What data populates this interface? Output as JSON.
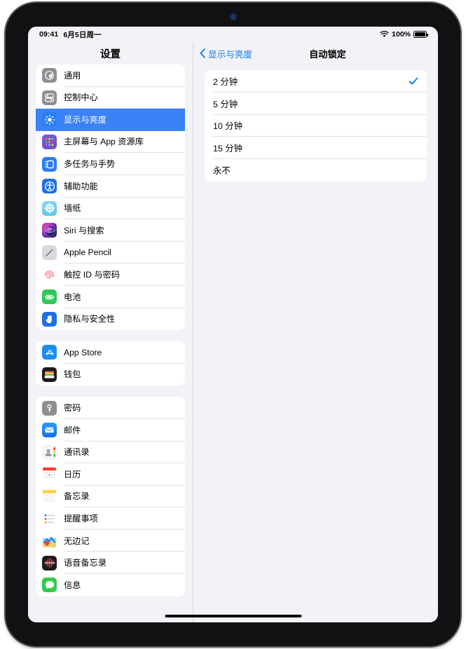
{
  "status_bar": {
    "time": "09:41",
    "date": "6月5日周一",
    "wifi_icon": "wifi-icon",
    "battery_percent": "100%",
    "battery_icon": "battery-full-icon"
  },
  "sidebar": {
    "title": "设置",
    "groups": [
      {
        "items": [
          {
            "label": "通用",
            "icon": "gear-icon",
            "icon_class": "ic-general",
            "selected": false
          },
          {
            "label": "控制中心",
            "icon": "control-center-icon",
            "icon_class": "ic-control",
            "selected": false
          },
          {
            "label": "显示与亮度",
            "icon": "brightness-icon",
            "icon_class": "ic-display",
            "selected": true
          },
          {
            "label": "主屏幕与 App 资源库",
            "icon": "app-grid-icon",
            "icon_class": "ic-home",
            "selected": false
          },
          {
            "label": "多任务与手势",
            "icon": "multitasking-icon",
            "icon_class": "ic-multi",
            "selected": false
          },
          {
            "label": "辅助功能",
            "icon": "accessibility-icon",
            "icon_class": "ic-access",
            "selected": false
          },
          {
            "label": "墙纸",
            "icon": "wallpaper-icon",
            "icon_class": "ic-wall",
            "selected": false
          },
          {
            "label": "Siri 与搜索",
            "icon": "siri-icon",
            "icon_class": "ic-siri",
            "selected": false
          },
          {
            "label": "Apple Pencil",
            "icon": "pencil-icon",
            "icon_class": "ic-pencil",
            "selected": false
          },
          {
            "label": "触控 ID 与密码",
            "icon": "fingerprint-icon",
            "icon_class": "ic-touch",
            "selected": false
          },
          {
            "label": "电池",
            "icon": "battery-icon",
            "icon_class": "ic-battery",
            "selected": false
          },
          {
            "label": "隐私与安全性",
            "icon": "hand-privacy-icon",
            "icon_class": "ic-privacy",
            "selected": false
          }
        ]
      },
      {
        "items": [
          {
            "label": "App Store",
            "icon": "appstore-icon",
            "icon_class": "ic-appstore",
            "selected": false
          },
          {
            "label": "钱包",
            "icon": "wallet-icon",
            "icon_class": "ic-wallet",
            "selected": false
          }
        ]
      },
      {
        "items": [
          {
            "label": "密码",
            "icon": "key-icon",
            "icon_class": "ic-password",
            "selected": false
          },
          {
            "label": "邮件",
            "icon": "mail-icon",
            "icon_class": "ic-mail",
            "selected": false
          },
          {
            "label": "通讯录",
            "icon": "contacts-icon",
            "icon_class": "ic-contacts",
            "selected": false
          },
          {
            "label": "日历",
            "icon": "calendar-icon",
            "icon_class": "ic-calendar",
            "selected": false
          },
          {
            "label": "备忘录",
            "icon": "notes-icon",
            "icon_class": "ic-notes",
            "selected": false
          },
          {
            "label": "提醒事项",
            "icon": "reminders-icon",
            "icon_class": "ic-reminder",
            "selected": false
          },
          {
            "label": "无边记",
            "icon": "freeform-icon",
            "icon_class": "ic-freeform",
            "selected": false
          },
          {
            "label": "语音备忘录",
            "icon": "voicememos-icon",
            "icon_class": "ic-voice",
            "selected": false
          },
          {
            "label": "信息",
            "icon": "messages-icon",
            "icon_class": "ic-messages",
            "selected": false
          }
        ]
      }
    ]
  },
  "content": {
    "back_label": "显示与亮度",
    "back_icon": "chevron-left-icon",
    "title": "自动锁定",
    "options": [
      {
        "label": "2 分钟",
        "selected": true
      },
      {
        "label": "5 分钟",
        "selected": false
      },
      {
        "label": "10 分钟",
        "selected": false
      },
      {
        "label": "15 分钟",
        "selected": false
      },
      {
        "label": "永不",
        "selected": false
      }
    ]
  },
  "colors": {
    "accent": "#1177f2",
    "selection": "#3b82f7",
    "page_bg": "#f2f2f7",
    "card_bg": "#ffffff"
  }
}
